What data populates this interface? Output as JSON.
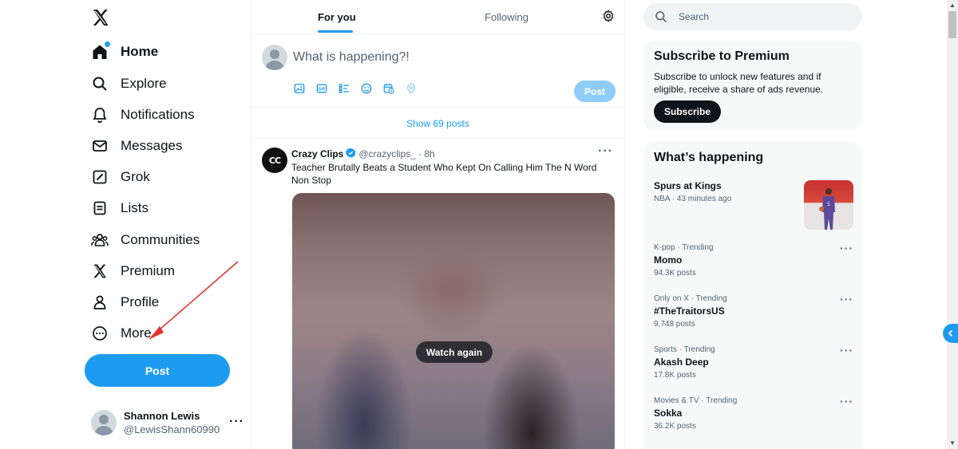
{
  "colors": {
    "accent": "#1d9bf0",
    "text": "#0f1419",
    "muted": "#536471",
    "panel": "#f7f9f9",
    "annotation_arrow": "#e0322d"
  },
  "nav": {
    "logo": "x-logo-icon",
    "items": [
      {
        "label": "Home",
        "icon": "home-icon"
      },
      {
        "label": "Explore",
        "icon": "search-icon"
      },
      {
        "label": "Notifications",
        "icon": "bell-icon"
      },
      {
        "label": "Messages",
        "icon": "envelope-icon"
      },
      {
        "label": "Grok",
        "icon": "grok-icon"
      },
      {
        "label": "Lists",
        "icon": "list-icon"
      },
      {
        "label": "Communities",
        "icon": "communities-icon"
      },
      {
        "label": "Premium",
        "icon": "x-logo-icon"
      },
      {
        "label": "Profile",
        "icon": "person-icon"
      },
      {
        "label": "More",
        "icon": "more-circle-icon"
      }
    ],
    "post_label": "Post"
  },
  "account": {
    "name": "Shannon Lewis",
    "handle": "@LewisShann60990",
    "more": "···"
  },
  "feed": {
    "tabs": [
      {
        "label": "For you"
      },
      {
        "label": "Following"
      }
    ],
    "composer_placeholder": "What is happening?!",
    "composer_post_label": "Post",
    "show_posts": "Show 69 posts",
    "tweet": {
      "avatar_text": "CC",
      "name": "Crazy Clips",
      "handle": "@crazyclips_",
      "time": "· 8h",
      "text": "Teacher Brutally Beats a Student Who Kept On Calling Him The N Word Non Stop",
      "media_button": "Watch again",
      "more": "···"
    }
  },
  "sidebar": {
    "search_placeholder": "Search",
    "premium": {
      "title": "Subscribe to Premium",
      "body": "Subscribe to unlock new features and if eligible, receive a share of ads revenue.",
      "button": "Subscribe"
    },
    "happening": {
      "title": "What’s happening",
      "event": {
        "title": "Spurs at Kings",
        "meta": "NBA · 43 minutes ago"
      },
      "trends": [
        {
          "meta": "K-pop · Trending",
          "name": "Momo",
          "count": "94.3K posts"
        },
        {
          "meta": "Only on X · Trending",
          "name": "#TheTraitorsUS",
          "count": "9,748 posts"
        },
        {
          "meta": "Sports · Trending",
          "name": "Akash Deep",
          "count": "17.8K posts"
        },
        {
          "meta": "Movies & TV · Trending",
          "name": "Sokka",
          "count": "36.2K posts"
        }
      ],
      "more": "···"
    }
  }
}
